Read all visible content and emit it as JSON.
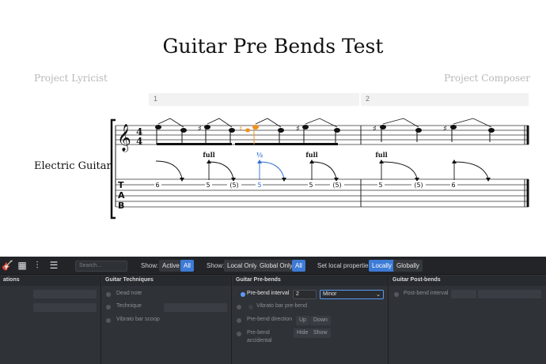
{
  "score": {
    "title": "Guitar Pre Bends Test",
    "lyricist": "Project Lyricist",
    "composer": "Project Composer",
    "instrument": "Electric Guitar",
    "measures": [
      "1",
      "2"
    ],
    "time_signature_top": "4",
    "time_signature_bottom": "4",
    "tab_clef": [
      "T",
      "A",
      "B"
    ],
    "bend_labels": [
      "full",
      "½",
      "full",
      "full"
    ],
    "tab_numbers": [
      "6",
      "5",
      "(5)",
      "5",
      "5",
      "(5)",
      "5",
      "(5)",
      "6"
    ]
  },
  "toolbar": {
    "search_placeholder": "Search...",
    "show_label": "Show:",
    "active_label": "Active",
    "all_label": "All",
    "show2_label": "Show:",
    "local_only_label": "Local Only",
    "global_only_label": "Global Only",
    "all2_label": "All",
    "set_local_label": "Set local properties:",
    "locally_label": "Locally",
    "globally_label": "Globally"
  },
  "panel": {
    "col0_header": "ations",
    "techniques": {
      "header": "Guitar Techniques",
      "dead_note": "Dead note",
      "technique": "Technique",
      "vibrato_scoop": "Vibrato bar scoop"
    },
    "prebends": {
      "header": "Guitar Pre-bends",
      "prebend_interval": "Pre-bend interval",
      "interval_value": "2",
      "interval_quality": "Minor",
      "vibrato_prebend": "Vibrato bar pre-bend",
      "direction_label": "Pre-bend direction",
      "up": "Up",
      "down": "Down",
      "accidental_label_1": "Pre-bend",
      "accidental_label_2": "accidental",
      "hide": "Hide",
      "show": "Show"
    },
    "postbends": {
      "header": "Guitar Post-bends",
      "postbend_interval": "Post-bend interval"
    }
  },
  "colors": {
    "accent": "#3d7bd6",
    "highlight_note": "#f0901e",
    "selected_bend": "#2f6fd0"
  }
}
